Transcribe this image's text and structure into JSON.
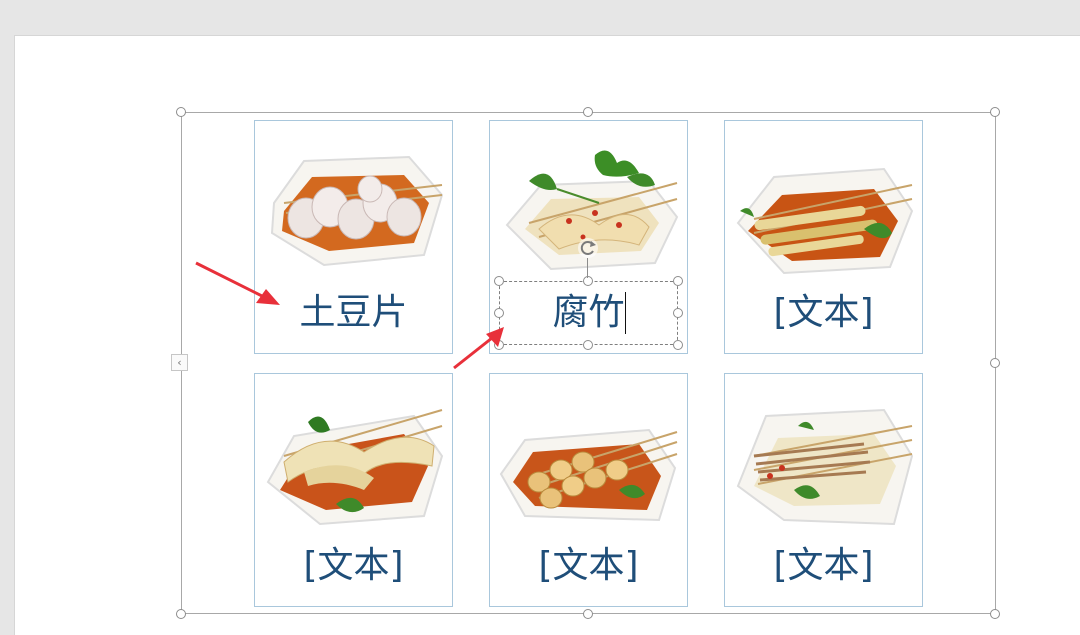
{
  "cards": [
    {
      "label": "土豆片",
      "dish": "potato slices on skewers"
    },
    {
      "label": "腐竹",
      "dish": "tofu skin on skewers with cilantro"
    },
    {
      "label": "[文本]",
      "dish": "bamboo shoots on skewers"
    },
    {
      "label": "[文本]",
      "dish": "sliced vegetables on skewers"
    },
    {
      "label": "[文本]",
      "dish": "quail eggs on skewers"
    },
    {
      "label": "[文本]",
      "dish": "enoki mushrooms on skewers"
    }
  ],
  "text_pane_toggle": "‹",
  "colors": {
    "label": "#1f4e79",
    "card_border": "#a9c7dc",
    "arrow": "#e8303a",
    "sauce": "#c8551a"
  }
}
